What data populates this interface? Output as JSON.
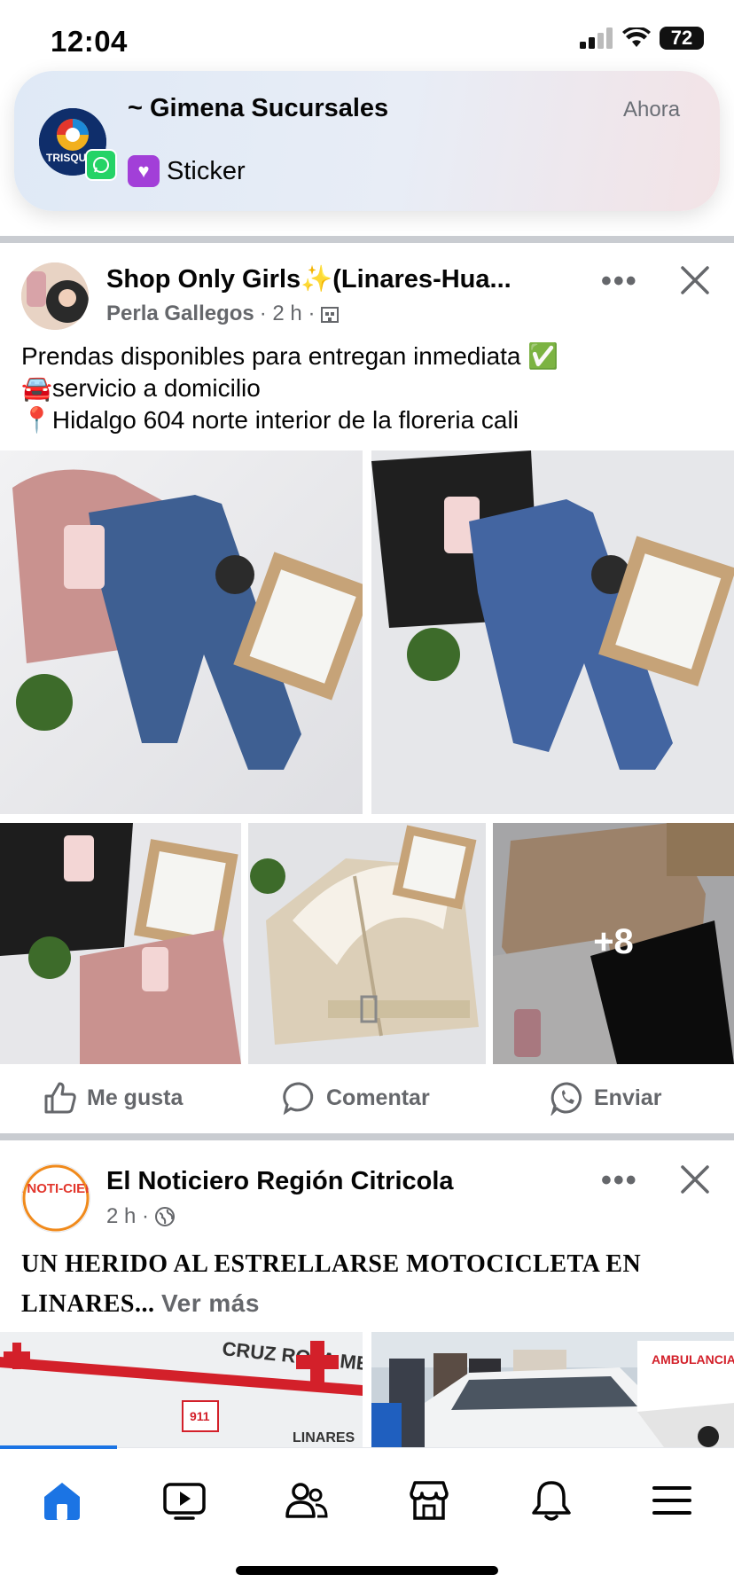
{
  "status_bar": {
    "time": "12:04",
    "battery": "72"
  },
  "notification": {
    "sender": "~ Gimena Sucursales",
    "message": "Sticker",
    "time": "Ahora",
    "avatar_text": "TRISQU"
  },
  "post1": {
    "page_name": "Shop Only Girls✨(Linares-Hua...",
    "author": "Perla Gallegos",
    "time": "· 2 h ·",
    "lines": [
      "Prendas disponibles para entregan inmediata ✅",
      "🚘servicio a domicilio",
      "📍Hidalgo 604 norte interior de la floreria cali"
    ],
    "more_photos": "+8",
    "actions": {
      "like": "Me gusta",
      "comment": "Comentar",
      "send": "Enviar"
    }
  },
  "post2": {
    "page_name": "El Noticiero Región Citricola",
    "time": "2 h ·",
    "avatar_text": "EL NOTI-CIERO",
    "text": "UN HERIDO AL ESTRELLARSE MOTOCICLETA EN LINARES...",
    "see_more": "Ver más",
    "ambulance_text": "CRUZ ROJA MEXICANA",
    "ambulance_num": "911",
    "ambulance_city": "LINARES",
    "ambulance2_text": "AMBULANCIA"
  },
  "icons": [
    "home-icon",
    "video-icon",
    "friends-icon",
    "marketplace-icon",
    "bell-icon",
    "menu-icon"
  ],
  "colors": {
    "accent": "#1b74e4",
    "muted": "#65676b"
  }
}
